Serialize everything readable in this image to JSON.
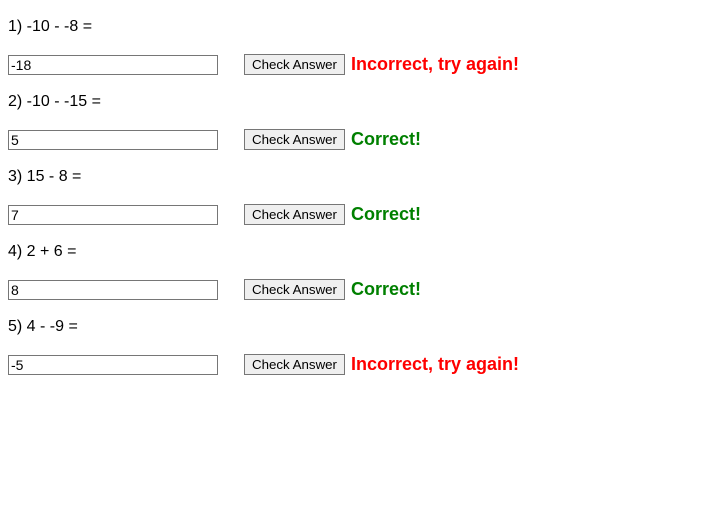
{
  "button_label": "Check Answer",
  "feedback_correct": "Correct!",
  "feedback_incorrect": "Incorrect, try again!",
  "problems": [
    {
      "question": "1) -10 - -8 =",
      "answer": "-18",
      "status": "incorrect"
    },
    {
      "question": "2) -10 - -15 =",
      "answer": "5",
      "status": "correct"
    },
    {
      "question": "3) 15 - 8 =",
      "answer": "7",
      "status": "correct"
    },
    {
      "question": "4) 2 + 6 =",
      "answer": "8",
      "status": "correct"
    },
    {
      "question": "5) 4 - -9 =",
      "answer": "-5",
      "status": "incorrect"
    }
  ]
}
